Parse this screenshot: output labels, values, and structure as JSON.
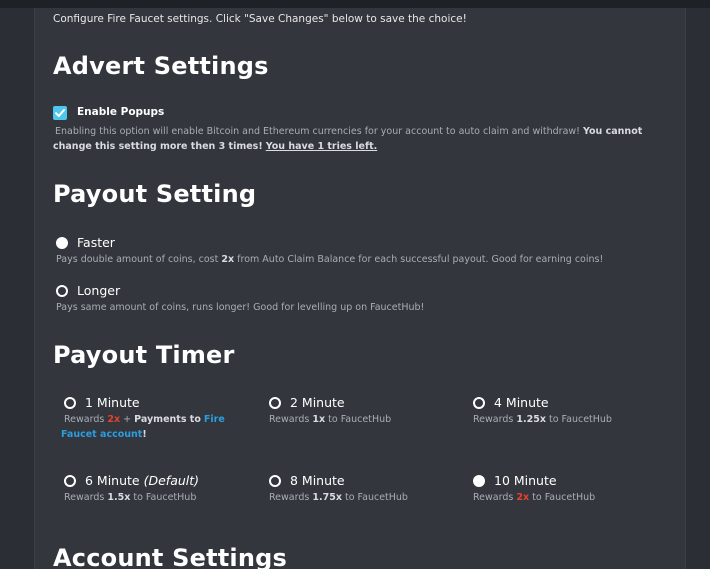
{
  "intro": "Configure Fire Faucet settings. Click \"Save Changes\" below to save the choice!",
  "advert": {
    "heading": "Advert Settings",
    "checkbox_label": "Enable Popups",
    "checkbox_checked": true,
    "desc_line1": "Enabling this option will enable Bitcoin and Ethereum currencies for your account to auto claim and withdraw!",
    "desc_line1_bold": "You cannot",
    "desc_line2_bold": "change this setting more then 3 times!",
    "desc_line2_link": "You have 1 tries left."
  },
  "payout_setting": {
    "heading": "Payout Setting",
    "options": [
      {
        "label": "Faster",
        "selected": true,
        "desc_pre": "Pays double amount of coins, cost",
        "desc_bold": "2x",
        "desc_post": "from Auto Claim Balance for each successful payout. Good for earning coins!"
      },
      {
        "label": "Longer",
        "selected": false,
        "desc": "Pays same amount of coins, runs longer! Good for levelling up on FaucetHub!"
      }
    ]
  },
  "payout_timer": {
    "heading": "Payout Timer",
    "options": [
      {
        "label": "1 Minute",
        "selected": false,
        "rewards": "Rewards",
        "mult": "2x",
        "plus": "+",
        "payments": "Payments to",
        "fire": "Fire",
        "faucet": "Faucet account",
        "excl": "!"
      },
      {
        "label": "2 Minute",
        "selected": false,
        "rewards": "Rewards",
        "mult": "1x",
        "suffix": "to FaucetHub"
      },
      {
        "label": "4 Minute",
        "selected": false,
        "rewards": "Rewards",
        "mult": "1.25x",
        "suffix": "to FaucetHub"
      },
      {
        "label": "6 Minute",
        "label_em": "(Default)",
        "selected": false,
        "rewards": "Rewards",
        "mult": "1.5x",
        "suffix": "to FaucetHub"
      },
      {
        "label": "8 Minute",
        "selected": false,
        "rewards": "Rewards",
        "mult": "1.75x",
        "suffix": "to FaucetHub"
      },
      {
        "label": "10 Minute",
        "selected": true,
        "rewards": "Rewards",
        "mult": "2x",
        "suffix": "to FaucetHub"
      }
    ]
  },
  "account": {
    "heading": "Account Settings"
  },
  "colors": {
    "page_bg": "#2b2e34",
    "panel_bg": "#33363d",
    "checkbox": "#4fc6ec",
    "red": "#e8412c",
    "blue": "#2b9ee0"
  }
}
